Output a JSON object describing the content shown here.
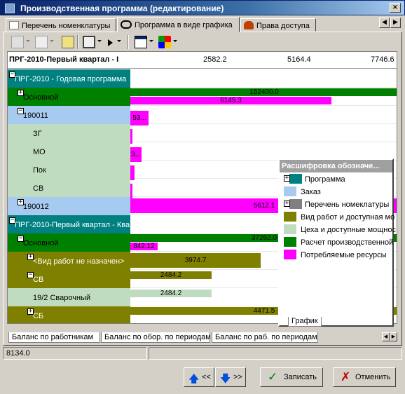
{
  "window": {
    "title": "Производственная программа (редактирование)",
    "close_label": "×"
  },
  "tabs": [
    {
      "label": "Перечень номенклатуры"
    },
    {
      "label": "Программа в виде графика"
    },
    {
      "label": "Права доступа"
    }
  ],
  "gantt": {
    "header_name": "ПРГ-2010-Первый квартал - I",
    "ticks": [
      "2582.2",
      "5164.4",
      "7746.6"
    ],
    "rows": [
      {
        "label": "ПРГ-2010 - Годовая программа",
        "expander": "−",
        "color": "#008080",
        "text_color": "#ffffff"
      },
      {
        "label": "Основной",
        "expander": "+",
        "color": "#008000",
        "text_color": "#000000",
        "bars": [
          {
            "value": "152400.0",
            "color": "#008000"
          },
          {
            "value": "6145.3",
            "color": "#ff00ff"
          }
        ]
      },
      {
        "label": "190011",
        "expander": "−",
        "color": "#a6caf0",
        "text_color": "#000000",
        "bars": [
          {
            "value": "53...",
            "color": "#ff00ff"
          }
        ]
      },
      {
        "label": "ЗГ",
        "color": "#c0dcc0",
        "text_color": "#000000",
        "bars": [
          {
            "value": "",
            "color": "#ff00ff"
          }
        ]
      },
      {
        "label": "МО",
        "color": "#c0dcc0",
        "text_color": "#000000",
        "bars": [
          {
            "value": "3...",
            "color": "#ff00ff"
          }
        ]
      },
      {
        "label": "Пок",
        "color": "#c0dcc0",
        "text_color": "#000000",
        "bars": [
          {
            "value": "",
            "color": "#ff00ff"
          }
        ]
      },
      {
        "label": "СВ",
        "color": "#c0dcc0",
        "text_color": "#000000",
        "bars": [
          {
            "value": "",
            "color": "#ff00ff"
          }
        ]
      },
      {
        "label": "190012",
        "expander": "+",
        "color": "#a6caf0",
        "text_color": "#000000",
        "bars": [
          {
            "value": "5612.1",
            "color": "#ff00ff"
          }
        ]
      },
      {
        "label": "ПРГ-2010-Первый квартал - Ква",
        "expander": "−",
        "color": "#008080",
        "text_color": "#ffffff"
      },
      {
        "label": "Основной",
        "expander": "−",
        "color": "#008000",
        "text_color": "#000000",
        "bars": [
          {
            "value": "37262.0",
            "color": "#008000"
          },
          {
            "value": "842.12",
            "color": "#ff00ff"
          }
        ]
      },
      {
        "label": "<Вид работ не назначен>",
        "expander": "+",
        "color": "#808000",
        "text_color": "#ffffff",
        "bars": [
          {
            "value": "3974.7",
            "color": "#808000"
          }
        ]
      },
      {
        "label": "СВ",
        "expander": "−",
        "color": "#808000",
        "text_color": "#ffffff",
        "bars": [
          {
            "value": "2484.2",
            "color": "#808000"
          }
        ]
      },
      {
        "label": "19/2 Сварочный",
        "color": "#c0dcc0",
        "text_color": "#000000",
        "bars": [
          {
            "value": "2484.2",
            "color": "#c0dcc0"
          }
        ]
      },
      {
        "label": "СБ",
        "expander": "+",
        "color": "#808000",
        "text_color": "#ffffff",
        "bars": [
          {
            "value": "4471.5",
            "color": "#808000"
          }
        ]
      }
    ]
  },
  "legend": {
    "title": "Расшифровка обозначе...",
    "items": [
      {
        "label": "Программа",
        "color": "#008080",
        "expander": true
      },
      {
        "label": "Заказ",
        "color": "#a6caf0"
      },
      {
        "label": "Перечень номеклатуры",
        "color": "#808080",
        "expander": true
      },
      {
        "label": "Вид работ и доступная мо",
        "color": "#808000"
      },
      {
        "label": "Цеха и доступные мощнос",
        "color": "#c0dcc0"
      },
      {
        "label": "Расчет производственной",
        "color": "#008000"
      },
      {
        "label": "Потребляемые ресурсы",
        "color": "#ff00ff"
      }
    ],
    "tab_label": "График"
  },
  "sheet_tabs": [
    {
      "label": "Баланс по работникам"
    },
    {
      "label": "Баланс по обор. по периодам"
    },
    {
      "label": "Баланс по раб. по периодам"
    }
  ],
  "status": {
    "value": "8134.0"
  },
  "buttons": {
    "prev": "<<",
    "next": ">>",
    "save": "Записать",
    "cancel": "Отменить"
  }
}
